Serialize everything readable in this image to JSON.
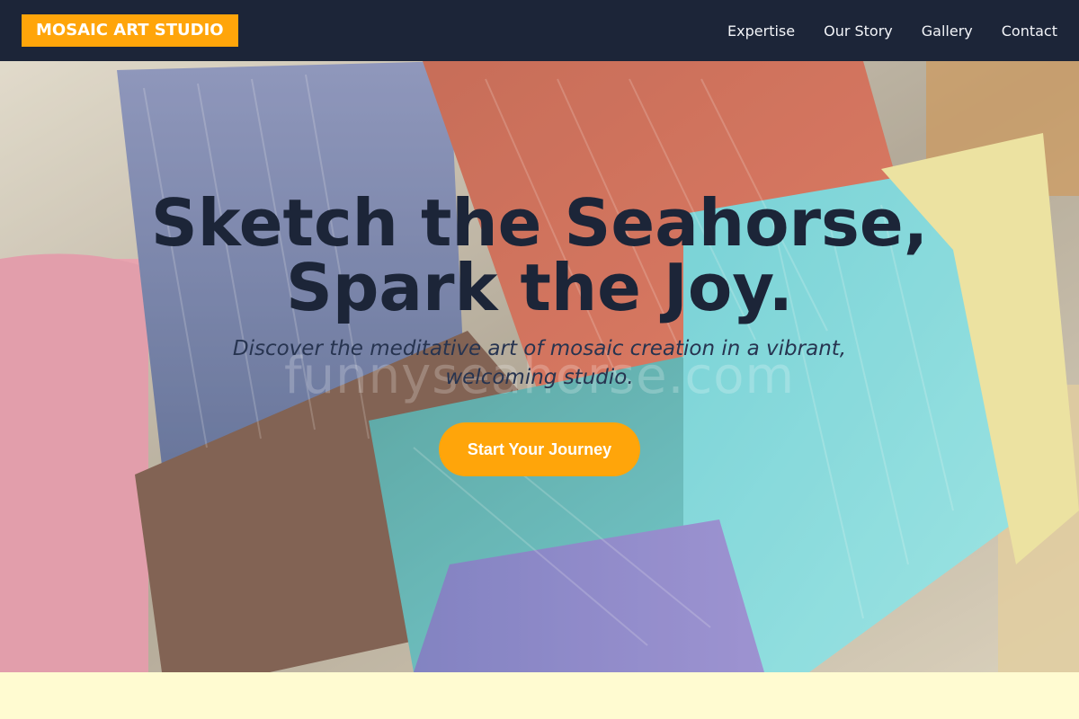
{
  "header": {
    "logo_text": "MOSAIC ART STUDIO",
    "nav": [
      "Expertise",
      "Our Story",
      "Gallery",
      "Contact"
    ]
  },
  "hero": {
    "title": "Sketch the Seahorse, Spark the Joy.",
    "subtitle": "Discover the meditative art of mosaic creation in a vibrant, welcoming studio.",
    "cta_label": "Start Your Journey",
    "watermark": "funnyseahorse.com"
  },
  "colors": {
    "header_bg": "#1c2538",
    "accent": "#ffa50a",
    "title_text": "#1c2538",
    "page_bg": "#fffbd1"
  },
  "icons": [
    "paint-brushes-background-image"
  ]
}
